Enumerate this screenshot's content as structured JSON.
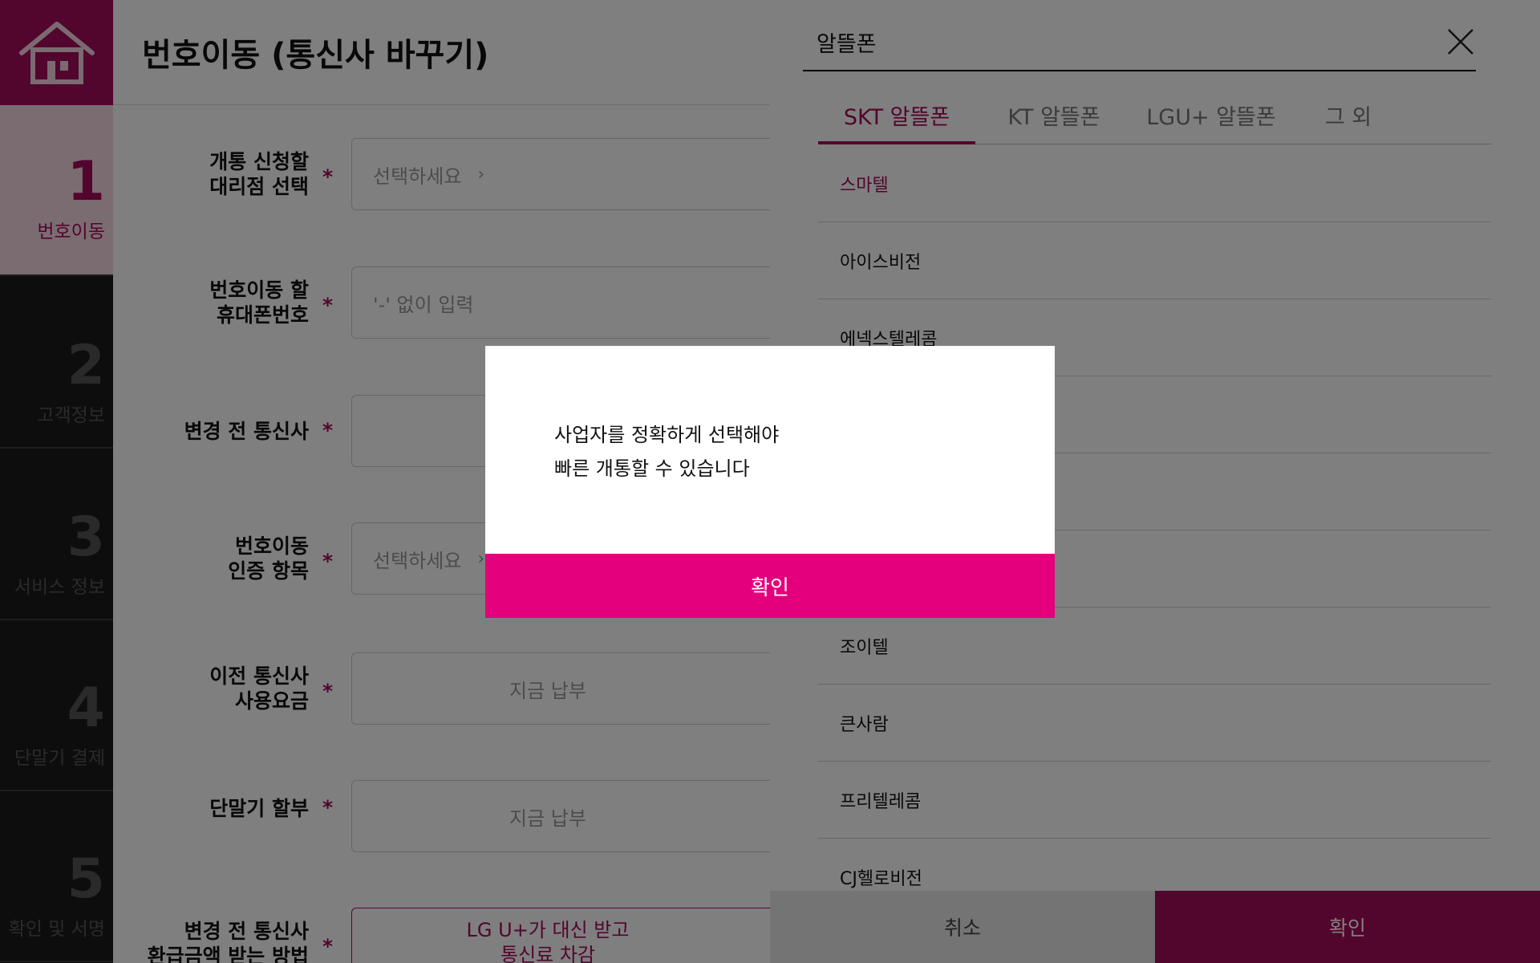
{
  "page": {
    "title": "번호이동 (통신사 바꾸기)"
  },
  "steps": [
    {
      "num": "1",
      "label": "번호이동",
      "active": true
    },
    {
      "num": "2",
      "label": "고객정보"
    },
    {
      "num": "3",
      "label": "서비스 정보"
    },
    {
      "num": "4",
      "label": "단말기 결제"
    },
    {
      "num": "5",
      "label": "확인 및 서명"
    }
  ],
  "form": {
    "agency": {
      "label_line1": "개통 신청할",
      "label_line2": "대리점 선택",
      "placeholder": "선택하세요"
    },
    "phone": {
      "label_line1": "번호이동 할",
      "label_line2": "휴대폰번호",
      "placeholder": "'-' 없이 입력"
    },
    "prev_carrier": {
      "label": "변경 전 통신사"
    },
    "auth": {
      "label_line1": "번호이동",
      "label_line2": "인증 항목",
      "placeholder": "선택하세요"
    },
    "prev_fee": {
      "label_line1": "이전 통신사",
      "label_line2": "사용요금",
      "value": "지금 납부"
    },
    "installment": {
      "label": "단말기 할부",
      "value": "지금 납부"
    },
    "refund": {
      "label_line1": "변경 전 통신사",
      "label_line2": "환급금액 받는 방법",
      "value_line1": "LG U+가 대신 받고",
      "value_line2": "통신료 차감"
    },
    "required_mark": "*"
  },
  "panel": {
    "title": "알뜰폰",
    "tabs": [
      "SKT 알뜰폰",
      "KT 알뜰폰",
      "LGU+ 알뜰폰",
      "그 외"
    ],
    "active_tab": "SKT 알뜰폰",
    "items": [
      "스마텔",
      "아이스비전",
      "에넥스텔레콤",
      "",
      "",
      "",
      "조이텔",
      "큰사람",
      "프리텔레콤",
      "CJ헬로비전"
    ],
    "selected_item": "스마텔",
    "cancel_label": "취소",
    "confirm_label": "확인"
  },
  "dialog": {
    "message": "사업자를 정확하게 선택해야\n빠른 개통할 수 있습니다",
    "ok_label": "확인"
  },
  "colors": {
    "brand": "#a50a5a",
    "dialog_button": "#e4007c"
  }
}
